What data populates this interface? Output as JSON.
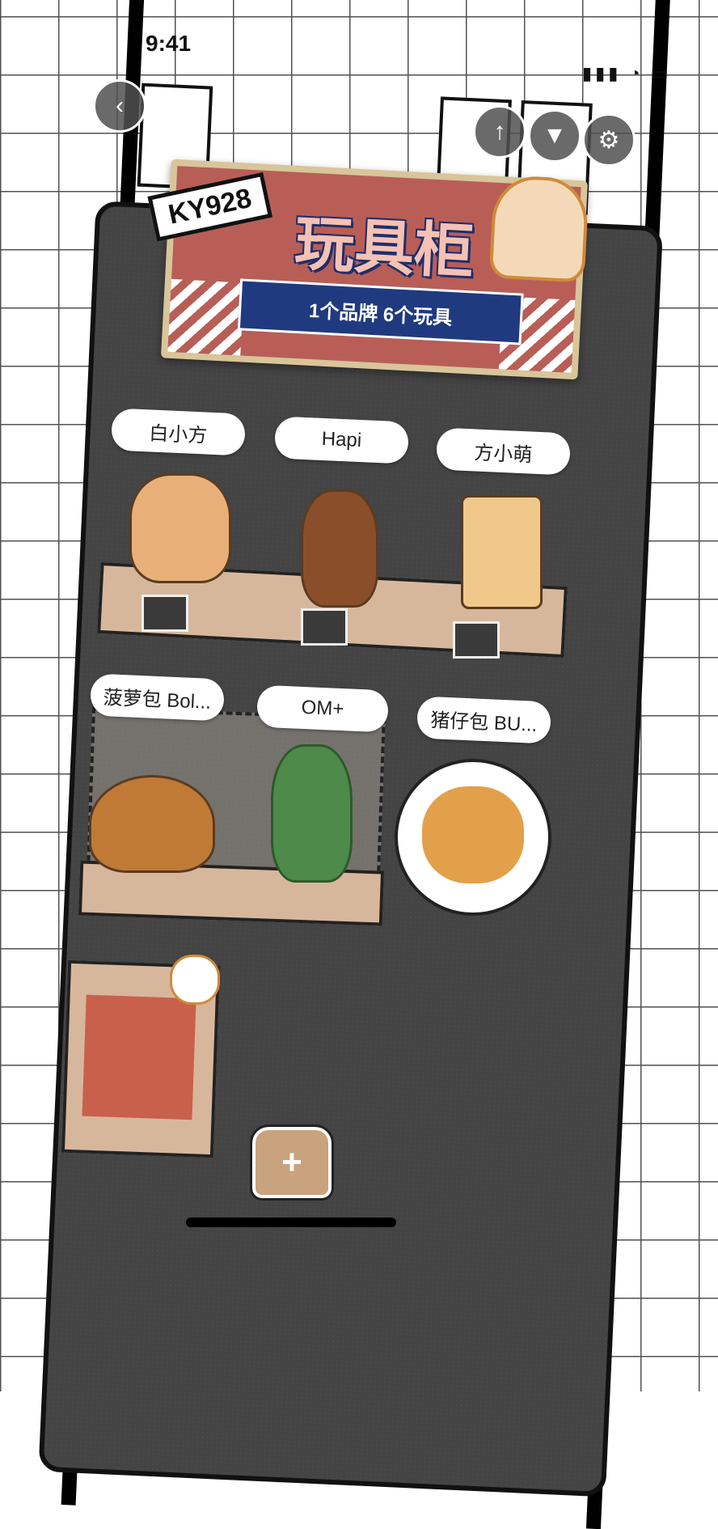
{
  "status_bar": {
    "time": "9:41",
    "icons": "▮▮▮ ◔ ▭"
  },
  "nav": {
    "back_icon": "‹",
    "upload_icon": "↑",
    "shirt_icon": "▼",
    "settings_icon": "⚙"
  },
  "banner": {
    "tag": "KY928",
    "title": "玩具柜",
    "subtitle": "1个品牌 6个玩具"
  },
  "shelf1": {
    "items": [
      {
        "name": "白小方"
      },
      {
        "name": "Hapi"
      },
      {
        "name": "方小萌"
      }
    ]
  },
  "shelf2": {
    "items": [
      {
        "name": "菠萝包 Bol..."
      },
      {
        "name": "OM+"
      },
      {
        "name": "猪仔包 BU..."
      }
    ]
  },
  "add_icon": "+"
}
